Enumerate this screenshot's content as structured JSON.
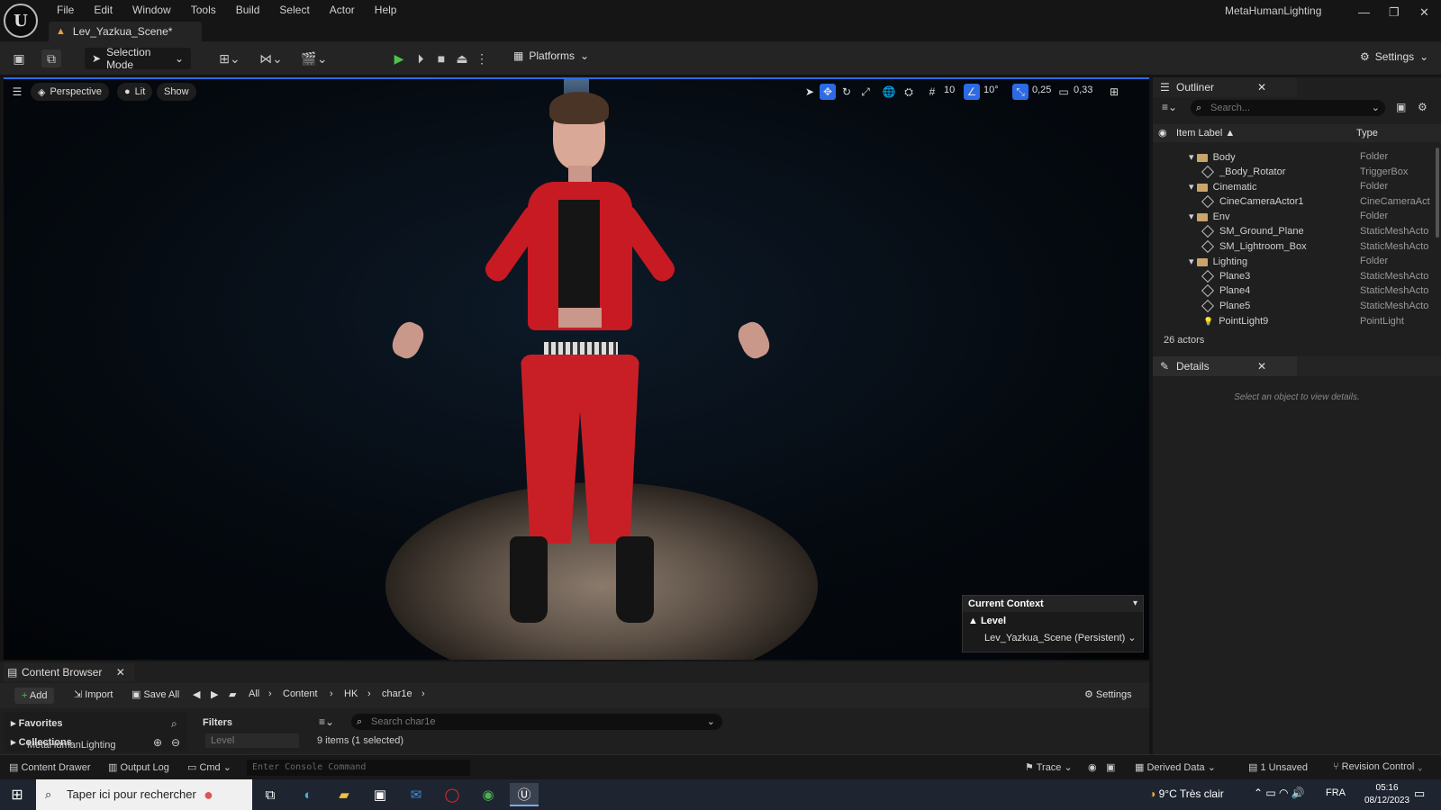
{
  "app": {
    "title": "MetaHumanLighting",
    "document_tab": "Lev_Yazkua_Scene*"
  },
  "menu": [
    "File",
    "Edit",
    "Window",
    "Tools",
    "Build",
    "Select",
    "Actor",
    "Help"
  ],
  "toolbar": {
    "selection_mode": "Selection Mode",
    "platforms": "Platforms",
    "settings": "Settings"
  },
  "viewport": {
    "perspective": "Perspective",
    "lit": "Lit",
    "show": "Show",
    "grid_snap": "10",
    "rotation_snap": "10°",
    "scale_snap": "0,25",
    "camera_speed": "0,33"
  },
  "current_context": {
    "title": "Current Context",
    "level": "Level",
    "scene": "Lev_Yazkua_Scene (Persistent)"
  },
  "outliner": {
    "tab": "Outliner",
    "search_placeholder": "Search...",
    "col_label": "Item Label ▲",
    "col_type": "Type",
    "rows": [
      {
        "label": "Body",
        "type": "Folder",
        "kind": "folder",
        "indent": 1
      },
      {
        "label": "_Body_Rotator",
        "type": "TriggerBox",
        "kind": "actor",
        "indent": 2
      },
      {
        "label": "Cinematic",
        "type": "Folder",
        "kind": "folder",
        "indent": 1
      },
      {
        "label": "CineCameraActor1",
        "type": "CineCameraAct",
        "kind": "actor",
        "indent": 2
      },
      {
        "label": "Env",
        "type": "Folder",
        "kind": "folder",
        "indent": 1
      },
      {
        "label": "SM_Ground_Plane",
        "type": "StaticMeshActo",
        "kind": "actor",
        "indent": 2
      },
      {
        "label": "SM_Lightroom_Box",
        "type": "StaticMeshActo",
        "kind": "actor",
        "indent": 2
      },
      {
        "label": "Lighting",
        "type": "Folder",
        "kind": "folder",
        "indent": 1
      },
      {
        "label": "Plane3",
        "type": "StaticMeshActo",
        "kind": "actor",
        "indent": 2
      },
      {
        "label": "Plane4",
        "type": "StaticMeshActo",
        "kind": "actor",
        "indent": 2
      },
      {
        "label": "Plane5",
        "type": "StaticMeshActo",
        "kind": "actor",
        "indent": 2
      },
      {
        "label": "PointLight9",
        "type": "PointLight",
        "kind": "light",
        "indent": 2
      }
    ],
    "actors_count": "26 actors"
  },
  "details": {
    "tab": "Details",
    "empty": "Select an object to view details."
  },
  "content_browser": {
    "tab": "Content Browser",
    "add": "Add",
    "import": "Import",
    "save_all": "Save All",
    "path": [
      "All",
      "Content",
      "HK",
      "char1e"
    ],
    "settings": "Settings",
    "favorites": "Favorites",
    "collections": "Collections",
    "project": "MetaHumanLighting",
    "filters": "Filters",
    "level_filter": "Level",
    "search_placeholder": "Search char1e",
    "items_count": "9 items (1 selected)"
  },
  "statusbar": {
    "content_drawer": "Content Drawer",
    "output_log": "Output Log",
    "cmd": "Cmd",
    "console_placeholder": "Enter Console Command",
    "trace": "Trace",
    "derived_data": "Derived Data",
    "unsaved": "1 Unsaved",
    "revision_control": "Revision Control"
  },
  "taskbar": {
    "search": "Taper ici pour rechercher",
    "weather": "9°C  Très clair",
    "lang": "FRA",
    "time": "05:16",
    "date": "08/12/2023"
  },
  "colors": {
    "accent": "#2b6be5",
    "jacket": "#c81a22",
    "folder": "#caa56b"
  }
}
